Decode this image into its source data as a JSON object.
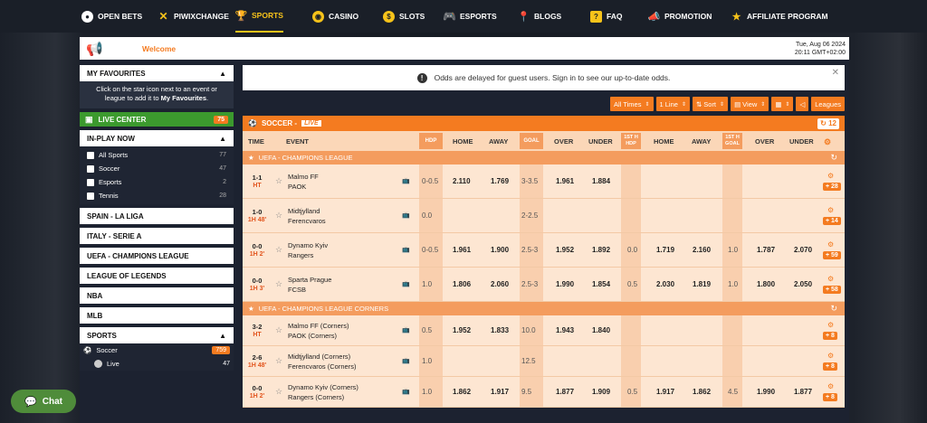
{
  "nav": [
    {
      "label": "OPEN BETS",
      "icon": "open-bets-icon"
    },
    {
      "label": "PIWIXCHANGE",
      "icon": "exchange-icon"
    },
    {
      "label": "SPORTS",
      "icon": "trophy-icon"
    },
    {
      "label": "CASINO",
      "icon": "casino-chip-icon"
    },
    {
      "label": "SLOTS",
      "icon": "slots-icon"
    },
    {
      "label": "ESPORTS",
      "icon": "gamepad-icon"
    },
    {
      "label": "BLOGS",
      "icon": "pin-icon"
    },
    {
      "label": "FAQ",
      "icon": "faq-icon"
    },
    {
      "label": "PROMOTION",
      "icon": "megaphone-icon"
    },
    {
      "label": "AFFILIATE PROGRAM",
      "icon": "affiliate-icon"
    }
  ],
  "welcome": {
    "text": "Welcome",
    "date": "Tue, Aug 06 2024",
    "time": "20:11 GMT+02:00"
  },
  "sidebar": {
    "favourites_title": "MY FAVOURITES",
    "favourites_note_1": "Click on the star icon next to an event or league to add it to ",
    "favourites_note_2": "My Favourites",
    "favourites_note_3": ".",
    "live_center": "LIVE CENTER",
    "live_center_count": "75",
    "inplay_title": "IN-PLAY NOW",
    "inplay_items": [
      {
        "label": "All Sports",
        "count": "77"
      },
      {
        "label": "Soccer",
        "count": "47"
      },
      {
        "label": "Esports",
        "count": "2"
      },
      {
        "label": "Tennis",
        "count": "28"
      }
    ],
    "quick_links": [
      "SPAIN - LA LIGA",
      "ITALY - SERIE A",
      "UEFA - CHAMPIONS LEAGUE",
      "LEAGUE OF LEGENDS",
      "NBA",
      "MLB"
    ],
    "sports_title": "SPORTS",
    "sports": [
      {
        "label": "Soccer",
        "count": "759"
      },
      {
        "label": "Live",
        "count": "47"
      }
    ]
  },
  "notice": "Odds are delayed for guest users. Sign in to see our up-to-date odds.",
  "filters": [
    "All Times",
    "1 Line",
    "Sort",
    "View",
    "Leagues"
  ],
  "table": {
    "sport": "SOCCER -",
    "live": "LIVE",
    "count": "12",
    "cols": {
      "time": "TIME",
      "event": "EVENT",
      "hdp": "HDP",
      "home": "HOME",
      "away": "AWAY",
      "goal": "GOAL",
      "over": "OVER",
      "under": "UNDER",
      "h1hdp": "1ST H HDP",
      "home2": "HOME",
      "away2": "AWAY",
      "h1goal": "1ST H GOAL",
      "over2": "OVER",
      "under2": "UNDER"
    },
    "leagues": [
      {
        "name": "UEFA - CHAMPIONS LEAGUE",
        "rows": [
          {
            "score": "1-1",
            "time": "HT",
            "home": "Malmo FF",
            "away": "PAOK",
            "hdp": "0-0.5",
            "h": "2.110",
            "a": "1.769",
            "goal": "3-3.5",
            "ov": "1.961",
            "un": "1.884",
            "hdp2": "",
            "h2": "",
            "a2": "",
            "goal2": "",
            "ov2": "",
            "un2": "",
            "more": "+ 28"
          },
          {
            "score": "1-0",
            "time": "1H 48'",
            "home": "Midtjylland",
            "away": "Ferencvaros",
            "hdp": "0.0",
            "h": "",
            "a": "",
            "goal": "2-2.5",
            "ov": "",
            "un": "",
            "hdp2": "",
            "h2": "",
            "a2": "",
            "goal2": "",
            "ov2": "",
            "un2": "",
            "more": "+ 14"
          },
          {
            "score": "0-0",
            "time": "1H 2'",
            "home": "Dynamo Kyiv",
            "away": "Rangers",
            "hdp": "0-0.5",
            "h": "1.961",
            "a": "1.900",
            "goal": "2.5-3",
            "ov": "1.952",
            "un": "1.892",
            "hdp2": "0.0",
            "h2": "1.719",
            "a2": "2.160",
            "goal2": "1.0",
            "ov2": "1.787",
            "un2": "2.070",
            "more": "+ 59"
          },
          {
            "score": "0-0",
            "time": "1H 3'",
            "home": "Sparta Prague",
            "away": "FCSB",
            "hdp": "1.0",
            "h": "1.806",
            "a": "2.060",
            "goal": "2.5-3",
            "ov": "1.990",
            "un": "1.854",
            "hdp2": "0.5",
            "h2": "2.030",
            "a2": "1.819",
            "goal2": "1.0",
            "ov2": "1.800",
            "un2": "2.050",
            "more": "+ 58"
          }
        ]
      },
      {
        "name": "UEFA - CHAMPIONS LEAGUE CORNERS",
        "rows": [
          {
            "score": "3-2",
            "time": "HT",
            "home": "Malmo FF (Corners)",
            "away": "PAOK (Corners)",
            "hdp": "0.5",
            "h": "1.952",
            "a": "1.833",
            "goal": "10.0",
            "ov": "1.943",
            "un": "1.840",
            "hdp2": "",
            "h2": "",
            "a2": "",
            "goal2": "",
            "ov2": "",
            "un2": "",
            "more": "+ 8"
          },
          {
            "score": "2-6",
            "time": "1H 48'",
            "home": "Midtjylland (Corners)",
            "away": "Ferencvaros (Corners)",
            "hdp": "1.0",
            "h": "",
            "a": "",
            "goal": "12.5",
            "ov": "",
            "un": "",
            "hdp2": "",
            "h2": "",
            "a2": "",
            "goal2": "",
            "ov2": "",
            "un2": "",
            "more": "+ 8"
          },
          {
            "score": "0-0",
            "time": "1H 2'",
            "home": "Dynamo Kyiv (Corners)",
            "away": "Rangers (Corners)",
            "hdp": "1.0",
            "h": "1.862",
            "a": "1.917",
            "goal": "9.5",
            "ov": "1.877",
            "un": "1.909",
            "hdp2": "0.5",
            "h2": "1.917",
            "a2": "1.862",
            "goal2": "4.5",
            "ov2": "1.990",
            "un2": "1.877",
            "more": "+ 8"
          }
        ]
      }
    ]
  },
  "chat": "Chat",
  "colors": {
    "accent": "#f47b20",
    "nav_active": "#f7c31a",
    "live_green": "#3c9a2e",
    "row_bg": "#fde6d2"
  }
}
